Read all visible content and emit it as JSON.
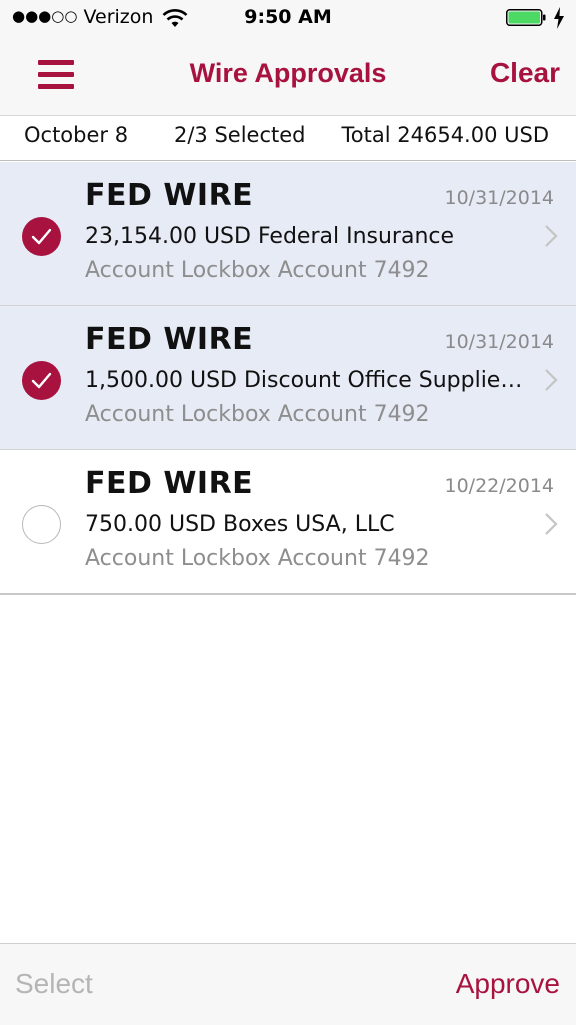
{
  "status_bar": {
    "signal_dots": "●●●○○",
    "carrier": "Verizon",
    "time": "9:50 AM",
    "wifi_icon": "wifi-icon",
    "battery_icon": "battery-icon",
    "battery_color": "#4cd964"
  },
  "nav": {
    "menu_icon": "hamburger-menu-icon",
    "title": "Wire Approvals",
    "clear_label": "Clear",
    "accent_color": "#a8123e"
  },
  "summary": {
    "date": "October 8",
    "selected": "2/3 Selected",
    "total": "Total 24654.00 USD"
  },
  "wires": [
    {
      "type": "FED WIRE",
      "date": "10/31/2014",
      "line": "23,154.00 USD Federal Insurance",
      "account": "Account Lockbox Account 7492",
      "selected": true
    },
    {
      "type": "FED WIRE",
      "date": "10/31/2014",
      "line": "1,500.00 USD Discount Office Supplie…",
      "account": "Account Lockbox Account 7492",
      "selected": true
    },
    {
      "type": "FED WIRE",
      "date": "10/22/2014",
      "line": "750.00 USD Boxes USA, LLC",
      "account": "Account Lockbox Account 7492",
      "selected": false
    }
  ],
  "bottom": {
    "select_label": "Select",
    "approve_label": "Approve"
  }
}
